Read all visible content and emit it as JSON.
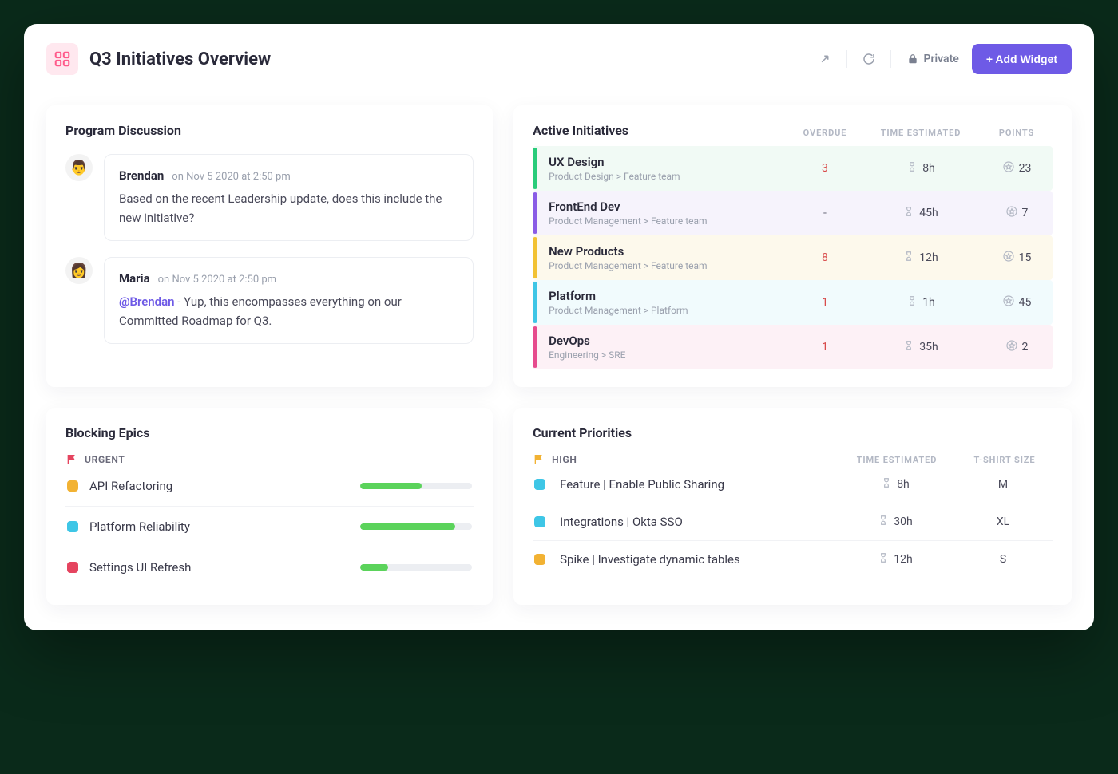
{
  "header": {
    "title": "Q3 Initiatives Overview",
    "privacy_label": "Private",
    "add_widget_label": "+ Add Widget"
  },
  "discussion": {
    "title": "Program Discussion",
    "comments": [
      {
        "author": "Brendan",
        "date": "on Nov 5 2020 at 2:50 pm",
        "body": "Based on the recent Leadership update, does this include the new initiative?",
        "avatar": "👨"
      },
      {
        "author": "Maria",
        "date": "on Nov 5 2020 at 2:50 pm",
        "mention": "@Brendan",
        "body": " - Yup, this encompasses everything on our Committed Roadmap for Q3.",
        "avatar": "👩"
      }
    ]
  },
  "initiatives": {
    "title": "Active Initiatives",
    "columns": {
      "overdue": "OVERDUE",
      "time": "TIME ESTIMATED",
      "points": "POINTS"
    },
    "rows": [
      {
        "name": "UX Design",
        "path": "Product Design > Feature team",
        "overdue": "3",
        "overdue_color": "#d84a4a",
        "time": "8h",
        "points": "23",
        "stripe": "#29cc7a",
        "bg": "#f1faf5"
      },
      {
        "name": "FrontEnd Dev",
        "path": "Product Management > Feature team",
        "overdue": "-",
        "overdue_color": "#6a6a7a",
        "time": "45h",
        "points": "7",
        "stripe": "#8a5ce6",
        "bg": "#f6f3fc"
      },
      {
        "name": "New Products",
        "path": "Product Management > Feature team",
        "overdue": "8",
        "overdue_color": "#d84a4a",
        "time": "12h",
        "points": "15",
        "stripe": "#f2c233",
        "bg": "#fdf9ec"
      },
      {
        "name": "Platform",
        "path": "Product Management > Platform",
        "overdue": "1",
        "overdue_color": "#d84a4a",
        "time": "1h",
        "points": "45",
        "stripe": "#3ec6e6",
        "bg": "#f1fbfd"
      },
      {
        "name": "DevOps",
        "path": "Engineering > SRE",
        "overdue": "1",
        "overdue_color": "#d84a4a",
        "time": "35h",
        "points": "2",
        "stripe": "#e64b8d",
        "bg": "#fdf1f6"
      }
    ]
  },
  "epics": {
    "title": "Blocking Epics",
    "flag_label": "URGENT",
    "flag_color": "#e5445f",
    "rows": [
      {
        "name": "API Refactoring",
        "color": "#f2b233",
        "progress": 55
      },
      {
        "name": "Platform Reliability",
        "color": "#3ec6e6",
        "progress": 85
      },
      {
        "name": "Settings UI Refresh",
        "color": "#e5445f",
        "progress": 25
      }
    ]
  },
  "priorities": {
    "title": "Current Priorities",
    "flag_label": "HIGH",
    "flag_color": "#f2b233",
    "columns": {
      "time": "TIME ESTIMATED",
      "size": "T-SHIRT SIZE"
    },
    "rows": [
      {
        "name": "Feature | Enable Public Sharing",
        "color": "#3ec6e6",
        "time": "8h",
        "size": "M"
      },
      {
        "name": "Integrations | Okta SSO",
        "color": "#3ec6e6",
        "time": "30h",
        "size": "XL"
      },
      {
        "name": "Spike | Investigate dynamic tables",
        "color": "#f2b233",
        "time": "12h",
        "size": "S"
      }
    ]
  }
}
